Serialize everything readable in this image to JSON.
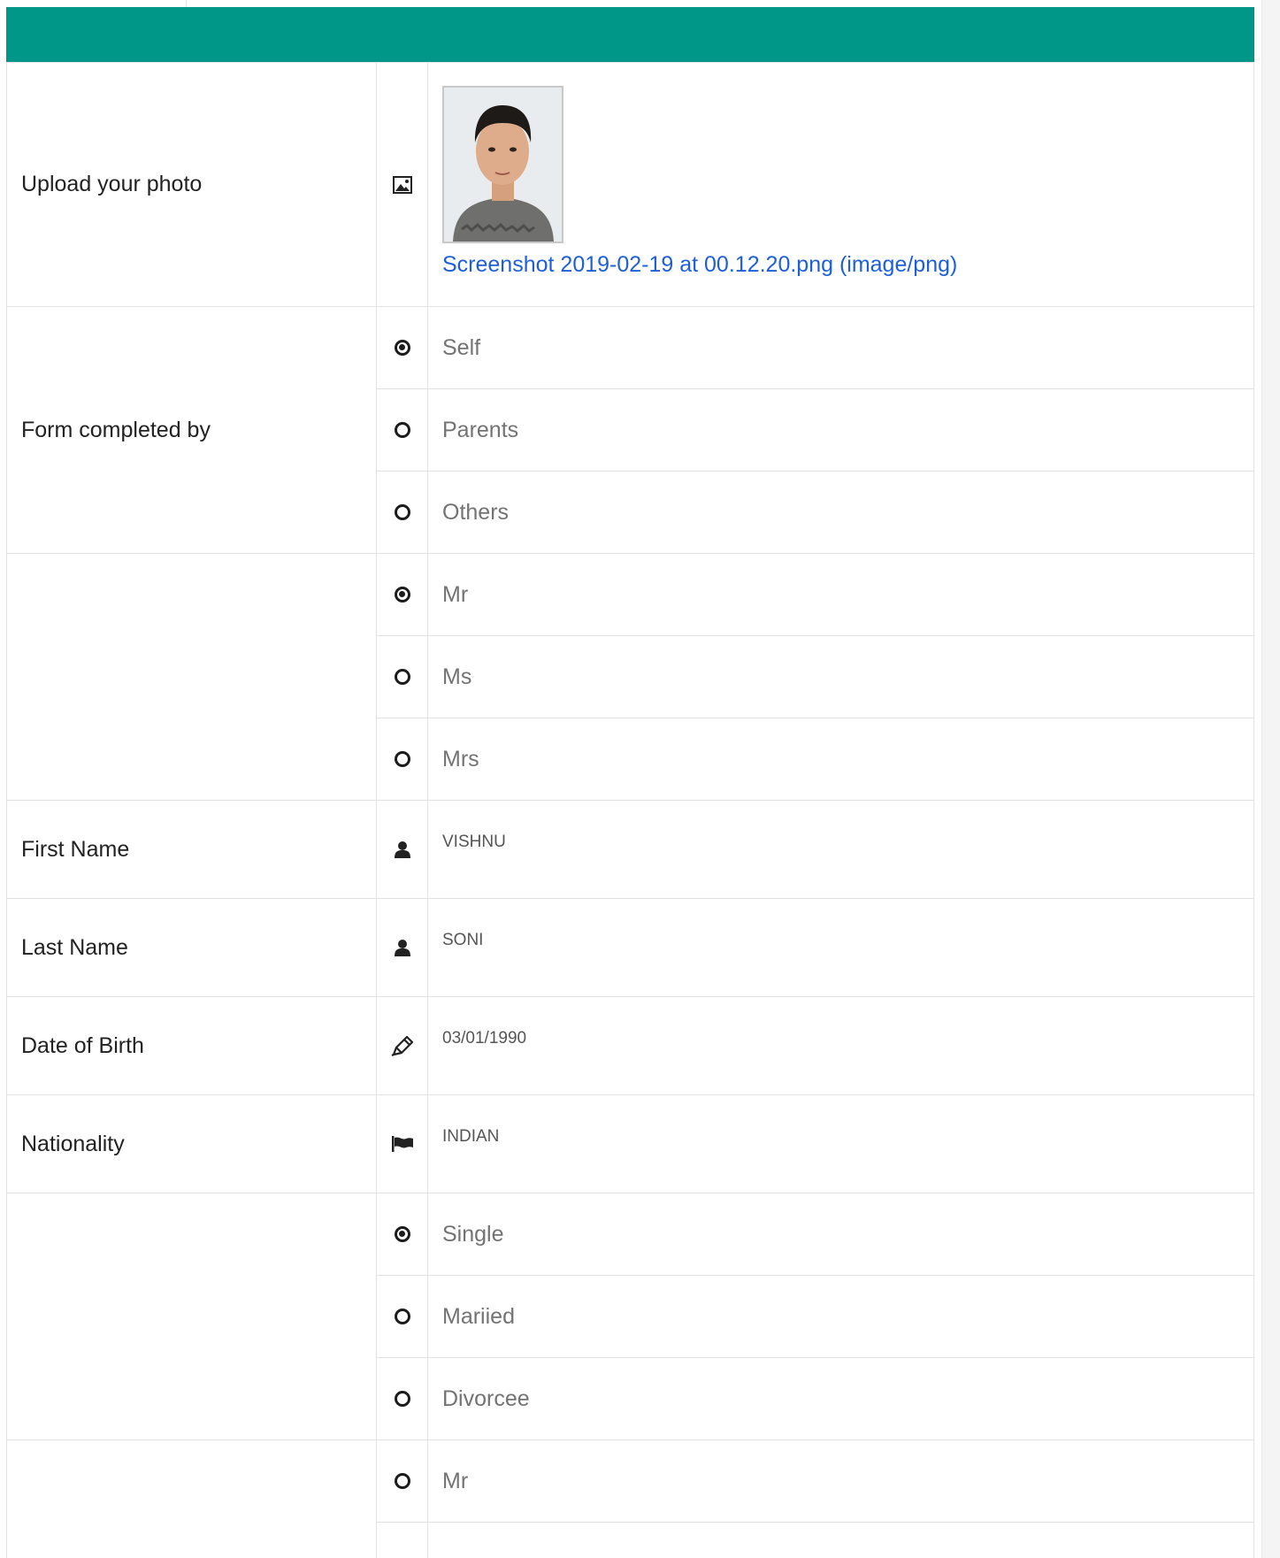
{
  "form": {
    "photo": {
      "label": "Upload your photo",
      "icon": "image-icon",
      "filename": "Screenshot 2019-02-19 at 00.12.20.png (image/png)"
    },
    "completed_by": {
      "label": "Form completed by",
      "options": [
        {
          "label": "Self",
          "checked": true
        },
        {
          "label": "Parents",
          "checked": false
        },
        {
          "label": "Others",
          "checked": false
        }
      ]
    },
    "title": {
      "label": "",
      "options": [
        {
          "label": "Mr",
          "checked": true
        },
        {
          "label": "Ms",
          "checked": false
        },
        {
          "label": "Mrs",
          "checked": false
        }
      ]
    },
    "first_name": {
      "label": "First Name",
      "value": "VISHNU",
      "icon": "user-icon"
    },
    "last_name": {
      "label": "Last Name",
      "value": "SONI",
      "icon": "user-icon"
    },
    "dob": {
      "label": "Date of Birth",
      "value": "03/01/1990",
      "icon": "pencil-icon"
    },
    "nationality": {
      "label": "Nationality",
      "value": "INDIAN",
      "icon": "flag-icon"
    },
    "marital_status": {
      "label": "",
      "options": [
        {
          "label": "Single",
          "checked": true
        },
        {
          "label": "Mariied",
          "checked": false
        },
        {
          "label": "Divorcee",
          "checked": false
        }
      ]
    },
    "second_title": {
      "label": "",
      "options": [
        {
          "label": "Mr",
          "checked": false
        }
      ]
    }
  },
  "colors": {
    "header": "#009688",
    "link": "#1e5fd9"
  }
}
